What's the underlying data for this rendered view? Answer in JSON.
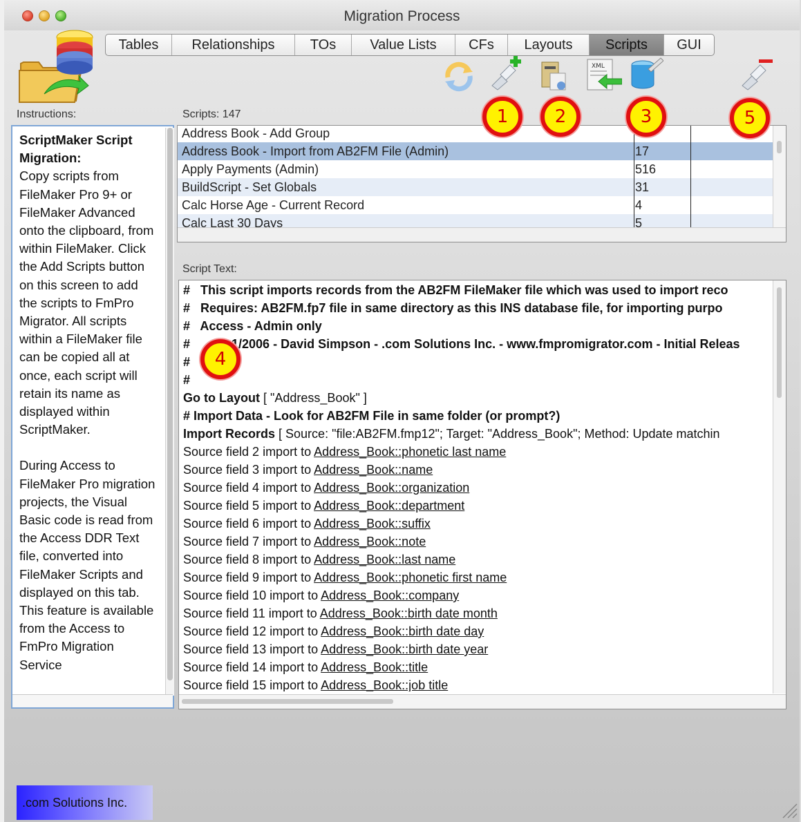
{
  "window": {
    "title": "Migration Process"
  },
  "tabs": [
    {
      "label": "Tables",
      "active": false
    },
    {
      "label": "Relationships",
      "active": false
    },
    {
      "label": "TOs",
      "active": false
    },
    {
      "label": "Value Lists",
      "active": false
    },
    {
      "label": "CFs",
      "active": false
    },
    {
      "label": "Layouts",
      "active": false
    },
    {
      "label": "Scripts",
      "active": true
    },
    {
      "label": "GUI",
      "active": false
    }
  ],
  "toolbar": {
    "icons": [
      "refresh-icon",
      "add-scripts-icon",
      "copy-script-icon",
      "export-xml-icon",
      "database-edit-icon",
      "remove-script-icon"
    ]
  },
  "instructions": {
    "label": "Instructions:",
    "title": "ScriptMaker Script Migration:",
    "body1": "Copy scripts from FileMaker Pro 9+ or FileMaker Advanced onto the clipboard, from within FileMaker. Click the Add Scripts button on this screen to add the scripts to FmPro Migrator. All scripts within a FileMaker file can be copied all at once, each script will retain its name as displayed within ScriptMaker.",
    "body2": "During Access to FileMaker Pro migration projects, the Visual Basic code is read from the Access DDR Text file, converted into FileMaker Scripts and displayed on this tab. This feature is available from the Access to FmPro Migration Service"
  },
  "scripts": {
    "label": "Scripts:",
    "count": "147",
    "rows": [
      {
        "name": "Address Book - Add Group",
        "count": ""
      },
      {
        "name": "Address Book - Import from AB2FM File (Admin)",
        "count": "17"
      },
      {
        "name": "Apply Payments (Admin)",
        "count": "516"
      },
      {
        "name": "BuildScript - Set Globals",
        "count": "31"
      },
      {
        "name": "Calc Horse Age - Current Record",
        "count": "4"
      },
      {
        "name": "Calc Last 30 Days",
        "count": "5"
      }
    ]
  },
  "script_text": {
    "label": "Script Text:",
    "lines": [
      {
        "hash": "#",
        "text": "This script imports records from the AB2FM FileMaker file which was used to import reco"
      },
      {
        "hash": "#",
        "text": "Requires: AB2FM.fp7 file in same directory as this INS database file, for importing purpo"
      },
      {
        "hash": "#",
        "text": "Access - Admin only"
      },
      {
        "hash": "#",
        "text": "1/2006 - David Simpson - .com Solutions Inc. - www.fmpromigrator.com - Initial Releas"
      },
      {
        "hash": "#",
        "text": ""
      },
      {
        "hash": "#",
        "text": ""
      }
    ],
    "goto_step": "Go to Layout",
    "goto_param": " [ \"Address_Book\" ]",
    "comment_import": "#  Import Data - Look for AB2FM File in same folder (or prompt?)",
    "import_step": "Import Records",
    "import_param": "  [ Source: \"file:AB2FM.fmp12\"; Target: \"Address_Book\"; Method: Update matchin",
    "field_lines": [
      {
        "prefix": "Source field 2 import to ",
        "field": "Address_Book::phonetic last name"
      },
      {
        "prefix": "Source field 3 import to ",
        "field": "Address_Book::name"
      },
      {
        "prefix": "Source field 4 import to ",
        "field": "Address_Book::organization"
      },
      {
        "prefix": "Source field 5 import to ",
        "field": "Address_Book::department"
      },
      {
        "prefix": "Source field 6 import to ",
        "field": "Address_Book::suffix"
      },
      {
        "prefix": "Source field 7 import to ",
        "field": "Address_Book::note"
      },
      {
        "prefix": "Source field 8 import to ",
        "field": "Address_Book::last name"
      },
      {
        "prefix": "Source field 9 import to ",
        "field": "Address_Book::phonetic first name"
      },
      {
        "prefix": "Source field 10 import to ",
        "field": "Address_Book::company"
      },
      {
        "prefix": "Source field 11 import to ",
        "field": "Address_Book::birth date month"
      },
      {
        "prefix": "Source field 12 import to ",
        "field": "Address_Book::birth date day"
      },
      {
        "prefix": "Source field 13 import to ",
        "field": "Address_Book::birth date year"
      },
      {
        "prefix": "Source field 14 import to ",
        "field": "Address_Book::title"
      },
      {
        "prefix": "Source field 15 import to ",
        "field": "Address_Book::job title"
      }
    ]
  },
  "callouts": [
    "1",
    "2",
    "3",
    "4",
    "5"
  ],
  "footer": {
    "company": ".com Solutions Inc."
  }
}
